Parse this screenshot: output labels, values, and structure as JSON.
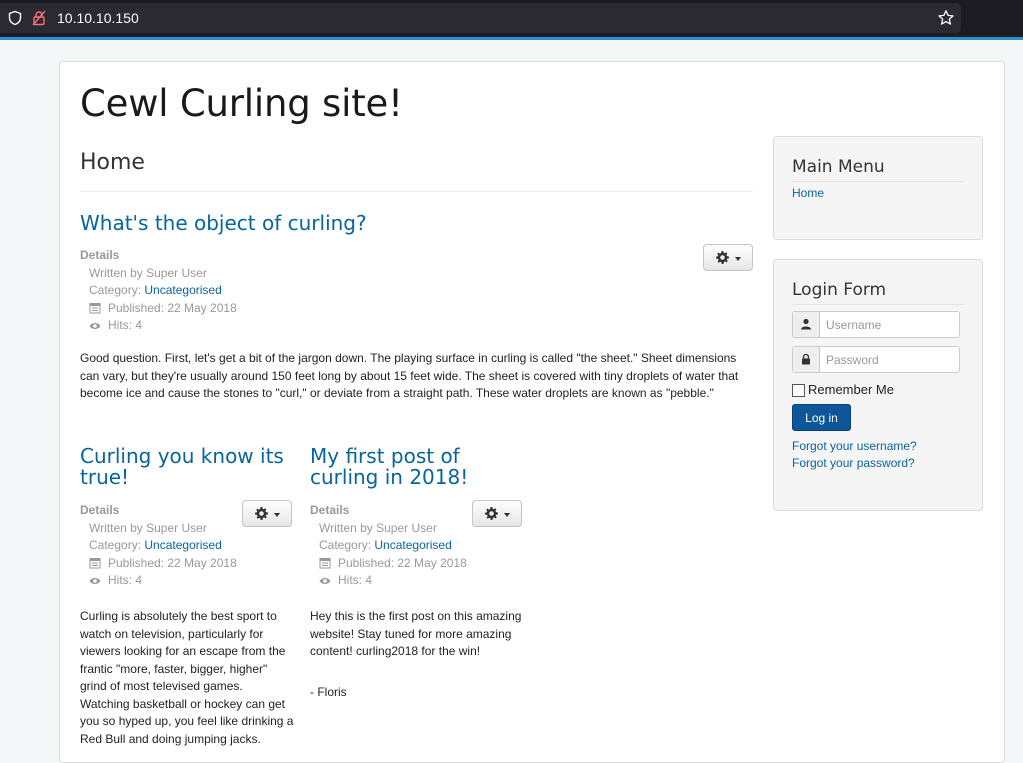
{
  "browser": {
    "url": "10.10.10.150"
  },
  "site": {
    "title": "Cewl Curling site!",
    "page_heading": "Home"
  },
  "articles": [
    {
      "title": "What's the object of curling?",
      "details_label": "Details",
      "author": "Written by Super User",
      "category_label": "Category:",
      "category": "Uncategorised",
      "published": "Published: 22 May 2018",
      "hits": "Hits: 4",
      "body": "Good question. First, let's get a bit of the jargon down. The playing surface in curling is called \"the sheet.\" Sheet dimensions can vary, but they're usually around 150 feet long by about 15 feet wide. The sheet is covered with tiny droplets of water that become ice and cause the stones to \"curl,\" or deviate from a straight path. These water droplets are known as \"pebble.\""
    },
    {
      "title": "Curling you know its true!",
      "details_label": "Details",
      "author": "Written by Super User",
      "category_label": "Category:",
      "category": "Uncategorised",
      "published": "Published: 22 May 2018",
      "hits": "Hits: 4",
      "body": "Curling is absolutely the best sport to watch on television, particularly for viewers looking for an escape from the frantic \"more, faster, bigger, higher\" grind of most televised games. Watching basketball or hockey can get you so hyped up, you feel like drinking a Red Bull and doing jumping jacks."
    },
    {
      "title": "My first post of curling in 2018!",
      "details_label": "Details",
      "author": "Written by Super User",
      "category_label": "Category:",
      "category": "Uncategorised",
      "published": "Published: 22 May 2018",
      "hits": "Hits: 4",
      "body": "Hey this is the first post on this amazing website! Stay tuned for more amazing content! curling2018 for the win!",
      "signature": "- Floris"
    }
  ],
  "main_menu": {
    "title": "Main Menu",
    "items": [
      "Home"
    ]
  },
  "login_form": {
    "title": "Login Form",
    "username_placeholder": "Username",
    "password_placeholder": "Password",
    "remember_label": "Remember Me",
    "login_button": "Log in",
    "forgot_username": "Forgot your username?",
    "forgot_password": "Forgot your password?"
  },
  "colors": {
    "link": "#08659c",
    "button_primary": "#0d5697",
    "browser_bar": "#1c1b22",
    "accent_line": "#2b8fd6"
  }
}
